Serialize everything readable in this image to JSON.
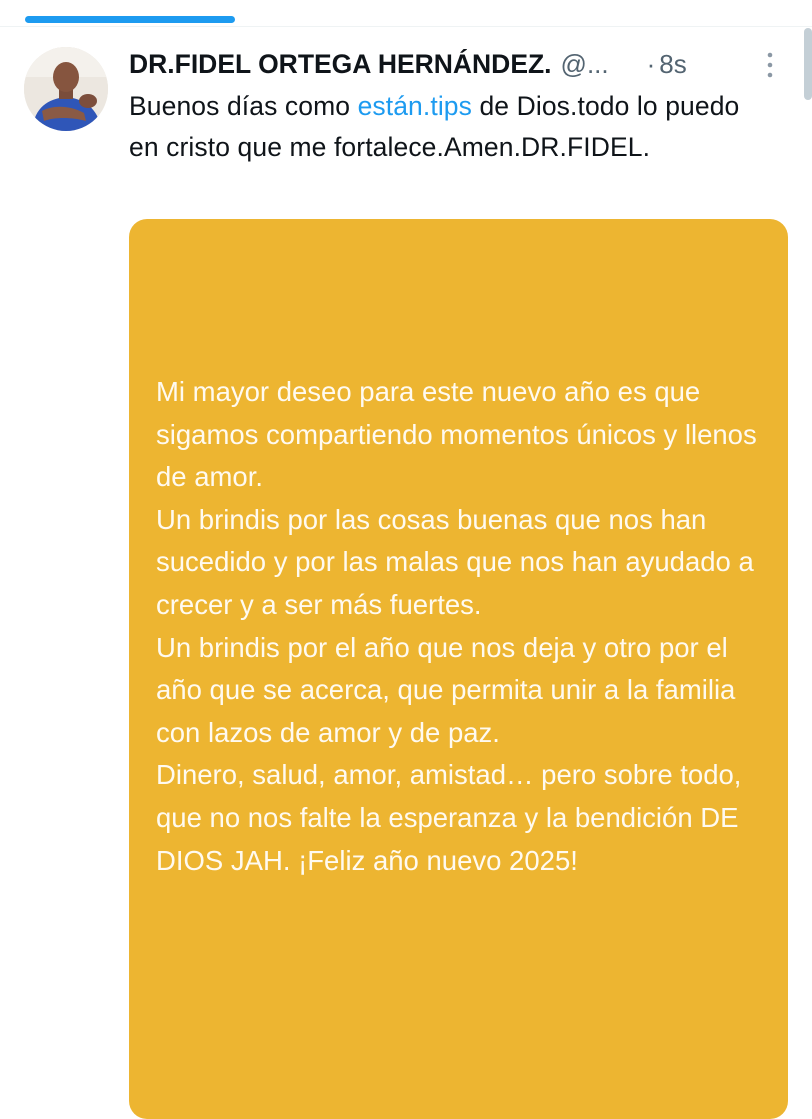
{
  "tweet": {
    "display_name": "DR.FIDEL ORTEGA HERNÁNDEZ.",
    "handle": "@...",
    "separator": "·",
    "time": "8s",
    "text_before_link": "Buenos días como ",
    "link_text": "están.tips",
    "text_after_link": " de Dios.todo lo puedo en cristo que me fortalece.Amen.DR.FIDEL."
  },
  "media": {
    "background_color": "#EDB531",
    "text": "Mi mayor deseo para este nuevo año es que sigamos compartiendo momentos únicos y llenos de amor.\nUn brindis por las cosas buenas que nos han sucedido y por las malas que nos han ayudado a crecer y a ser más fuertes.\nUn brindis por el año que nos deja y otro por el año que se acerca, que permita unir a la familia con lazos de amor y de paz.\nDinero, salud, amor, amistad… pero sobre todo, que no nos falte la esperanza y la bendición DE DIOS JAH. ¡Feliz año nuevo 2025!"
  },
  "icons": {
    "more": "more-vertical-icon",
    "avatar": "profile-avatar"
  },
  "colors": {
    "accent": "#1D9BF0",
    "secondary_text": "#536471"
  }
}
